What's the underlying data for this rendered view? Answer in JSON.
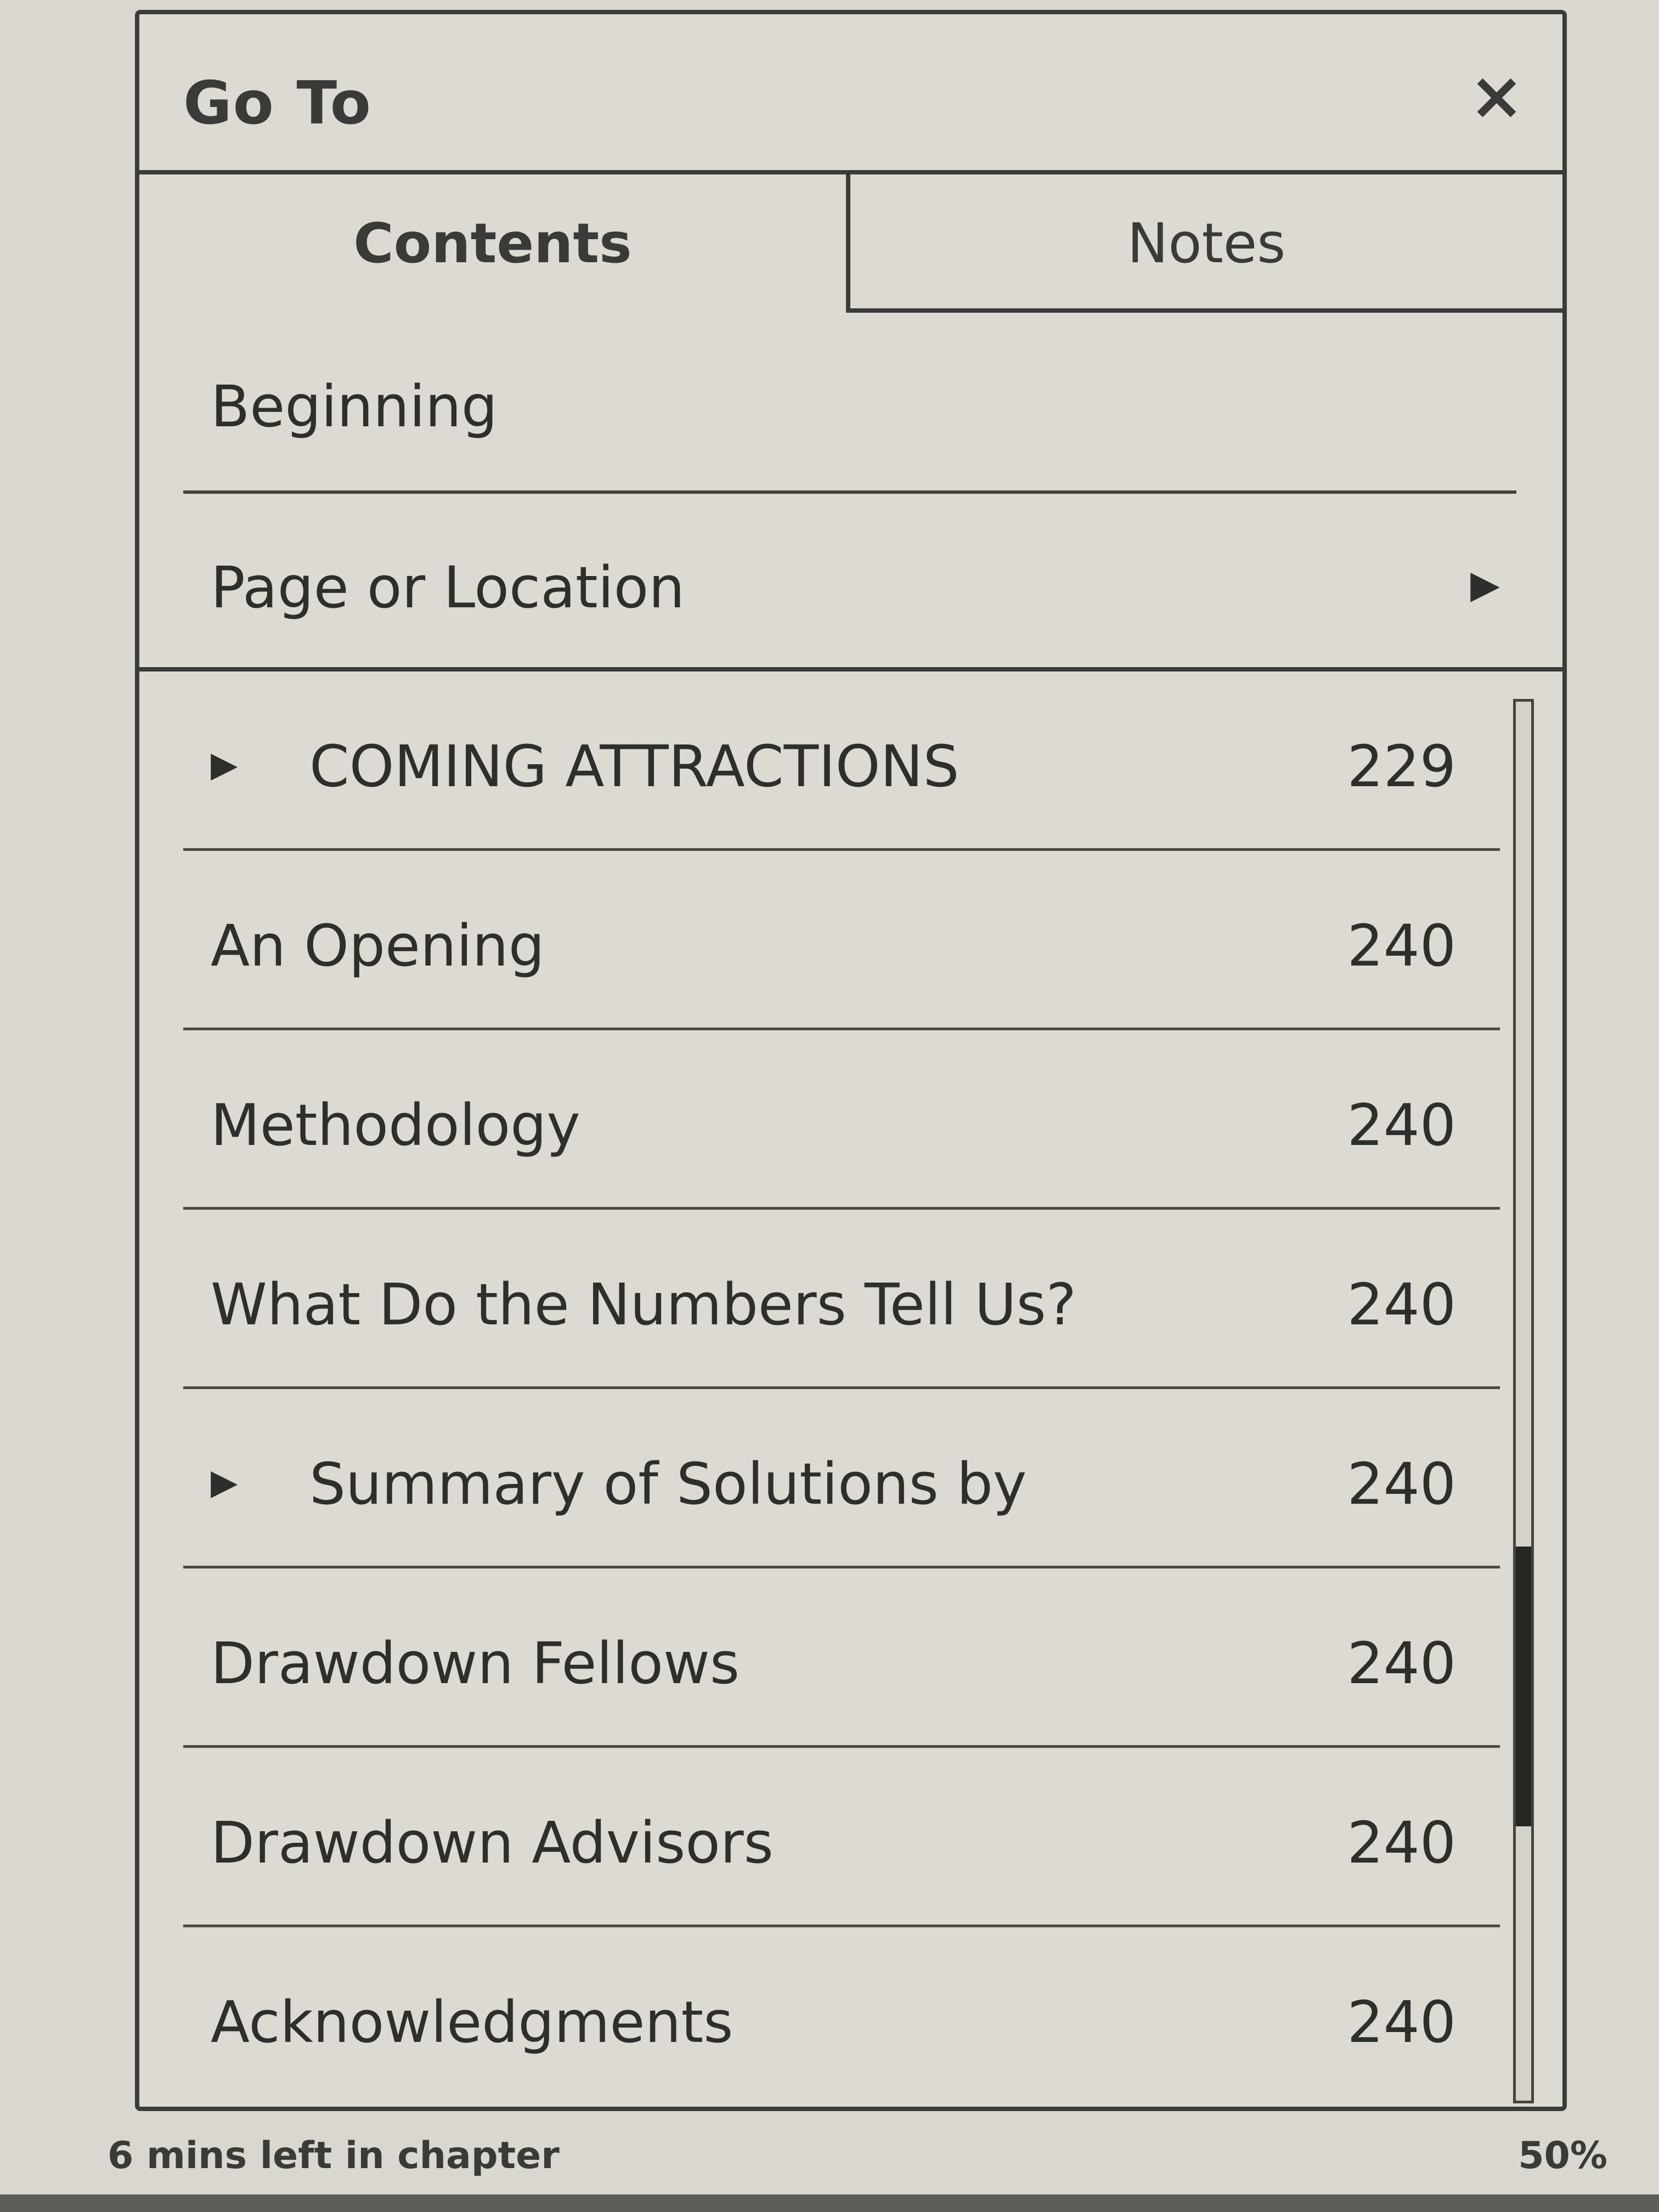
{
  "dialog": {
    "title": "Go To",
    "close_icon": "×"
  },
  "tabs": [
    {
      "label": "Contents",
      "selected": true
    },
    {
      "label": "Notes",
      "selected": false
    }
  ],
  "nav": {
    "beginning": "Beginning",
    "page_or_location": "Page or Location",
    "page_or_location_arrow": "▶"
  },
  "toc": [
    {
      "title": "COMING ATTRACTIONS",
      "page": "229",
      "expandable": true
    },
    {
      "title": "An Opening",
      "page": "240",
      "expandable": false
    },
    {
      "title": "Methodology",
      "page": "240",
      "expandable": false
    },
    {
      "title": "What Do the Numbers Tell Us?",
      "page": "240",
      "expandable": false
    },
    {
      "title": "Summary of Solutions by",
      "page": "240",
      "expandable": true
    },
    {
      "title": "Drawdown Fellows",
      "page": "240",
      "expandable": false
    },
    {
      "title": "Drawdown Advisors",
      "page": "240",
      "expandable": false
    },
    {
      "title": "Acknowledgments",
      "page": "240",
      "expandable": false
    }
  ],
  "expand_icon": "▶",
  "scroll_position": 0.6,
  "status": {
    "time_left": "6 mins left in chapter",
    "progress": "50%"
  }
}
